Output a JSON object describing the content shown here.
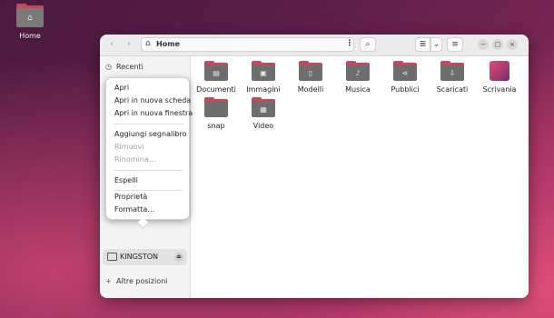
{
  "desktop": {
    "home_label": "Home",
    "home_icon": "home-folder-icon"
  },
  "headerbar": {
    "path_label": "Home",
    "back_icon": "‹",
    "forward_icon": "›",
    "menu_dots": "⋮",
    "search_icon": "⌕",
    "view_icon": "≣",
    "view_dropdown_icon": "⌄",
    "main_menu_icon": "≡",
    "minimize_icon": "−",
    "maximize_icon": "□",
    "close_icon": "×"
  },
  "sidebar": {
    "recent_label": "Recenti",
    "recent_icon": "◷",
    "kingston_label": "KINGSTON",
    "eject_icon": "⏏",
    "other_locations_label": "Altre posizioni",
    "other_locations_icon": "+"
  },
  "context_menu": {
    "items": [
      "Apri",
      "Apri in nuova scheda",
      "Apri in nuova finestra",
      "Aggiungi segnalibro",
      "Rimuovi",
      "Rinomina…",
      "Espelli",
      "Proprietà",
      "Formatta…"
    ]
  },
  "folders": [
    {
      "label": "Documenti",
      "icon": "document-icon",
      "glyph": "▤"
    },
    {
      "label": "Immagini",
      "icon": "image-icon",
      "glyph": "▣"
    },
    {
      "label": "Modelli",
      "icon": "template-icon",
      "glyph": "▯"
    },
    {
      "label": "Musica",
      "icon": "music-icon",
      "glyph": "♪"
    },
    {
      "label": "Pubblici",
      "icon": "share-icon",
      "glyph": "⋖"
    },
    {
      "label": "Scaricati",
      "icon": "download-icon",
      "glyph": "⇩"
    },
    {
      "label": "Scrivania",
      "icon": "desktop-icon",
      "glyph": ""
    },
    {
      "label": "snap",
      "icon": "folder-icon",
      "glyph": ""
    },
    {
      "label": "Video",
      "icon": "video-icon",
      "glyph": "▦"
    }
  ],
  "colors": {
    "folder_accent": "#c2495b",
    "folder_body": "#6d6d6d"
  }
}
